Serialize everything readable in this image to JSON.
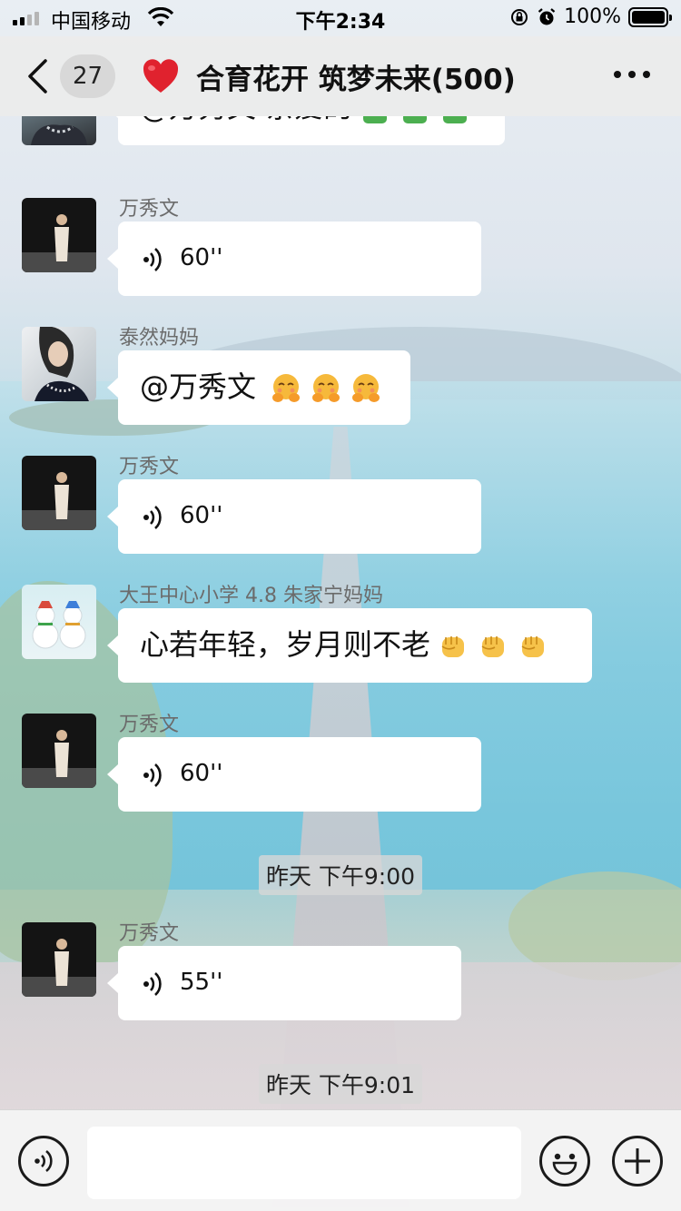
{
  "status_bar": {
    "carrier": "中国移动",
    "time": "下午2:34",
    "battery": "100%",
    "signal_bars": 4,
    "signal_active": 2
  },
  "header": {
    "back_badge": "27",
    "title": "合育花开 筑梦未来(500)",
    "title_icon": "heart-icon",
    "accent_color": "#e0222e"
  },
  "messages": [
    {
      "type": "text",
      "sender": "",
      "text": "@万秀文 亲爱的",
      "emoji": [
        "hug-icon",
        "hug-icon",
        "hug-icon"
      ]
    },
    {
      "type": "voice",
      "sender": "万秀文",
      "duration": "60''"
    },
    {
      "type": "text",
      "sender": "泰然妈妈",
      "text": "@万秀文",
      "emoji": [
        "blush-icon",
        "blush-icon",
        "blush-icon"
      ]
    },
    {
      "type": "voice",
      "sender": "万秀文",
      "duration": "60''"
    },
    {
      "type": "text",
      "sender": "大王中心小学 4.8 朱家宁妈妈",
      "text": "心若年轻，岁月则不老",
      "emoji": [
        "fist-icon",
        "fist-icon",
        "fist-icon"
      ]
    },
    {
      "type": "voice",
      "sender": "万秀文",
      "duration": "60''"
    },
    {
      "type": "timestamp",
      "text": "昨天 下午9:00"
    },
    {
      "type": "voice",
      "sender": "万秀文",
      "duration": "55''"
    },
    {
      "type": "timestamp",
      "text": "昨天 下午9:01"
    }
  ],
  "input_bar": {
    "voice_icon": "voice-mode-icon",
    "text_value": "",
    "emoji_icon": "smiley-icon",
    "plus_icon": "plus-icon"
  }
}
